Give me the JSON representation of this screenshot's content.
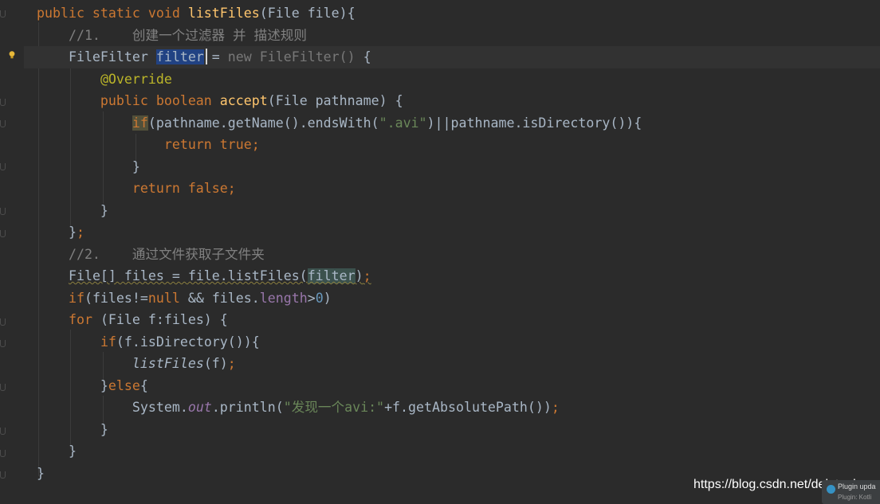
{
  "editor": {
    "language": "Java",
    "theme_colors": {
      "background": "#2b2b2b",
      "keyword": "#cc7832",
      "function_decl": "#ffc66d",
      "comment": "#808080",
      "string": "#6a8759",
      "number": "#6897bb",
      "annotation": "#bbb529",
      "field": "#9876aa",
      "default_text": "#a9b7c6",
      "selection": "#214283"
    },
    "lines": [
      {
        "current": false,
        "tokens": [
          {
            "t": "public static void ",
            "c": "kw"
          },
          {
            "t": "listFiles",
            "c": "fn"
          },
          {
            "t": "(File file){",
            "c": "mth"
          }
        ]
      },
      {
        "current": false,
        "tokens": [
          {
            "t": "    //1.    创建一个过滤器 并 描述规则",
            "c": "cm"
          }
        ]
      },
      {
        "current": true,
        "tokens": [
          {
            "t": "    FileFilter ",
            "c": "mth"
          },
          {
            "t": "filter",
            "c": "sel"
          },
          {
            "t": " = ",
            "c": "mth"
          },
          {
            "t": "new FileFilter() ",
            "c": "hint"
          },
          {
            "t": "{",
            "c": "mth"
          }
        ]
      },
      {
        "current": false,
        "tokens": [
          {
            "t": "        ",
            "c": "mth"
          },
          {
            "t": "@Override",
            "c": "ann"
          }
        ]
      },
      {
        "current": false,
        "tokens": [
          {
            "t": "        public boolean ",
            "c": "kw"
          },
          {
            "t": "accept",
            "c": "fn"
          },
          {
            "t": "(File pathname) {",
            "c": "mth"
          }
        ]
      },
      {
        "current": false,
        "tokens": [
          {
            "t": "            ",
            "c": "mth"
          },
          {
            "t": "if",
            "c": "kw-if"
          },
          {
            "t": "(pathname.getName().endsWith(",
            "c": "mth"
          },
          {
            "t": "\".avi\"",
            "c": "str"
          },
          {
            "t": ")||pathname.isDirectory()){",
            "c": "mth"
          }
        ]
      },
      {
        "current": false,
        "tokens": [
          {
            "t": "                return true;",
            "c": "kw"
          }
        ]
      },
      {
        "current": false,
        "tokens": [
          {
            "t": "            }",
            "c": "mth"
          }
        ]
      },
      {
        "current": false,
        "tokens": [
          {
            "t": "            return false;",
            "c": "kw"
          }
        ]
      },
      {
        "current": false,
        "tokens": [
          {
            "t": "        }",
            "c": "mth"
          }
        ]
      },
      {
        "current": false,
        "tokens": [
          {
            "t": "    }",
            "c": "mth"
          },
          {
            "t": ";",
            "c": "kw"
          }
        ]
      },
      {
        "current": false,
        "tokens": [
          {
            "t": "    //2.    通过文件获取子文件夹",
            "c": "cm"
          }
        ]
      },
      {
        "current": false,
        "tokens": [
          {
            "t": "    ",
            "c": "mth"
          },
          {
            "t": "File[] files = file.listFiles(",
            "c": "warn"
          },
          {
            "t": "filter",
            "c": "hl-warn"
          },
          {
            "t": ")",
            "c": "warn"
          },
          {
            "t": ";",
            "c": "kw-warn"
          }
        ]
      },
      {
        "current": false,
        "tokens": [
          {
            "t": "    ",
            "c": "mth"
          },
          {
            "t": "if",
            "c": "kw"
          },
          {
            "t": "(files!=",
            "c": "mth"
          },
          {
            "t": "null ",
            "c": "kw"
          },
          {
            "t": "&& files.",
            "c": "mth"
          },
          {
            "t": "length",
            "c": "member"
          },
          {
            "t": ">",
            "c": "mth"
          },
          {
            "t": "0",
            "c": "num"
          },
          {
            "t": ")",
            "c": "mth"
          }
        ]
      },
      {
        "current": false,
        "tokens": [
          {
            "t": "    ",
            "c": "mth"
          },
          {
            "t": "for ",
            "c": "kw"
          },
          {
            "t": "(File f:files) {",
            "c": "mth"
          }
        ]
      },
      {
        "current": false,
        "tokens": [
          {
            "t": "        ",
            "c": "mth"
          },
          {
            "t": "if",
            "c": "kw"
          },
          {
            "t": "(f.isDirectory()){",
            "c": "mth"
          }
        ]
      },
      {
        "current": false,
        "tokens": [
          {
            "t": "            ",
            "c": "mth"
          },
          {
            "t": "listFiles",
            "c": "ital"
          },
          {
            "t": "(f)",
            "c": "mth"
          },
          {
            "t": ";",
            "c": "kw"
          }
        ]
      },
      {
        "current": false,
        "tokens": [
          {
            "t": "        }",
            "c": "mth"
          },
          {
            "t": "else",
            "c": "kw"
          },
          {
            "t": "{",
            "c": "mth"
          }
        ]
      },
      {
        "current": false,
        "tokens": [
          {
            "t": "            System.",
            "c": "mth"
          },
          {
            "t": "out",
            "c": "fld"
          },
          {
            "t": ".println(",
            "c": "mth"
          },
          {
            "t": "\"发现一个avi:\"",
            "c": "str"
          },
          {
            "t": "+f.getAbsolutePath())",
            "c": "mth"
          },
          {
            "t": ";",
            "c": "kw"
          }
        ]
      },
      {
        "current": false,
        "tokens": [
          {
            "t": "        }",
            "c": "mth"
          }
        ]
      },
      {
        "current": false,
        "tokens": [
          {
            "t": "    }",
            "c": "mth"
          }
        ]
      },
      {
        "current": false,
        "tokens": [
          {
            "t": "}",
            "c": "mth"
          }
        ]
      }
    ]
  },
  "watermark": {
    "text": "https://blog.csdn.net/delete_bug"
  },
  "plugin_notification": {
    "title": "Plugin upda",
    "subtitle": "Plugin: Kotli",
    "icon": "info-icon"
  }
}
